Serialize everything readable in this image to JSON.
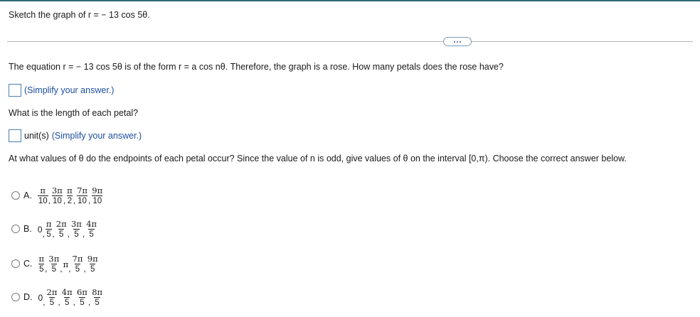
{
  "problem": {
    "statement": "Sketch the graph of r = − 13 cos 5θ."
  },
  "more_button": {
    "icon": "ellipsis-icon"
  },
  "question1": {
    "text": "The equation r = − 13 cos 5θ is of the form r = a cos nθ. Therefore, the graph is a rose. How many petals does the rose have?",
    "answer_value": "",
    "hint": "(Simplify your answer.)"
  },
  "question2": {
    "text": "What is the length of each petal?",
    "answer_value": "",
    "unit": "unit(s)",
    "hint": "(Simplify your answer.)"
  },
  "question3": {
    "text": "At what values of θ do the endpoints of each petal occur? Since the value of n is odd, give values of θ on the interval [0,π). Choose the correct answer below."
  },
  "choices": [
    {
      "letter": "A.",
      "terms": [
        {
          "num": "π",
          "den": "10"
        },
        {
          "num": "3π",
          "den": "10"
        },
        {
          "num": "π",
          "den": "2"
        },
        {
          "num": "7π",
          "den": "10"
        },
        {
          "num": "9π",
          "den": "10"
        }
      ]
    },
    {
      "letter": "B.",
      "terms": [
        {
          "plain": "0"
        },
        {
          "num": "π",
          "den": "5"
        },
        {
          "num": "2π",
          "den": "5"
        },
        {
          "num": "3π",
          "den": "5"
        },
        {
          "num": "4π",
          "den": "5"
        }
      ]
    },
    {
      "letter": "C.",
      "terms": [
        {
          "num": "π",
          "den": "5"
        },
        {
          "num": "3π",
          "den": "5"
        },
        {
          "plain": "π"
        },
        {
          "num": "7π",
          "den": "5"
        },
        {
          "num": "9π",
          "den": "5"
        }
      ]
    },
    {
      "letter": "D.",
      "terms": [
        {
          "plain": "0"
        },
        {
          "num": "2π",
          "den": "5"
        },
        {
          "num": "4π",
          "den": "5"
        },
        {
          "num": "6π",
          "den": "5"
        },
        {
          "num": "8π",
          "den": "5"
        }
      ]
    }
  ]
}
